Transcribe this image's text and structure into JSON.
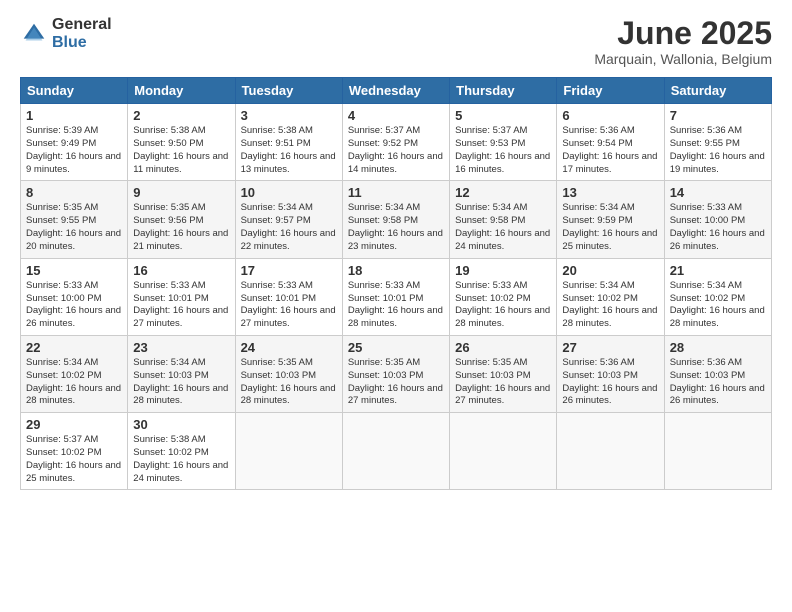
{
  "logo": {
    "general": "General",
    "blue": "Blue"
  },
  "title": "June 2025",
  "location": "Marquain, Wallonia, Belgium",
  "weekdays": [
    "Sunday",
    "Monday",
    "Tuesday",
    "Wednesday",
    "Thursday",
    "Friday",
    "Saturday"
  ],
  "weeks": [
    [
      {
        "day": 1,
        "sunrise": "5:39 AM",
        "sunset": "9:49 PM",
        "daylight": "16 hours and 9 minutes."
      },
      {
        "day": 2,
        "sunrise": "5:38 AM",
        "sunset": "9:50 PM",
        "daylight": "16 hours and 11 minutes."
      },
      {
        "day": 3,
        "sunrise": "5:38 AM",
        "sunset": "9:51 PM",
        "daylight": "16 hours and 13 minutes."
      },
      {
        "day": 4,
        "sunrise": "5:37 AM",
        "sunset": "9:52 PM",
        "daylight": "16 hours and 14 minutes."
      },
      {
        "day": 5,
        "sunrise": "5:37 AM",
        "sunset": "9:53 PM",
        "daylight": "16 hours and 16 minutes."
      },
      {
        "day": 6,
        "sunrise": "5:36 AM",
        "sunset": "9:54 PM",
        "daylight": "16 hours and 17 minutes."
      },
      {
        "day": 7,
        "sunrise": "5:36 AM",
        "sunset": "9:55 PM",
        "daylight": "16 hours and 19 minutes."
      }
    ],
    [
      {
        "day": 8,
        "sunrise": "5:35 AM",
        "sunset": "9:55 PM",
        "daylight": "16 hours and 20 minutes."
      },
      {
        "day": 9,
        "sunrise": "5:35 AM",
        "sunset": "9:56 PM",
        "daylight": "16 hours and 21 minutes."
      },
      {
        "day": 10,
        "sunrise": "5:34 AM",
        "sunset": "9:57 PM",
        "daylight": "16 hours and 22 minutes."
      },
      {
        "day": 11,
        "sunrise": "5:34 AM",
        "sunset": "9:58 PM",
        "daylight": "16 hours and 23 minutes."
      },
      {
        "day": 12,
        "sunrise": "5:34 AM",
        "sunset": "9:58 PM",
        "daylight": "16 hours and 24 minutes."
      },
      {
        "day": 13,
        "sunrise": "5:34 AM",
        "sunset": "9:59 PM",
        "daylight": "16 hours and 25 minutes."
      },
      {
        "day": 14,
        "sunrise": "5:33 AM",
        "sunset": "10:00 PM",
        "daylight": "16 hours and 26 minutes."
      }
    ],
    [
      {
        "day": 15,
        "sunrise": "5:33 AM",
        "sunset": "10:00 PM",
        "daylight": "16 hours and 26 minutes."
      },
      {
        "day": 16,
        "sunrise": "5:33 AM",
        "sunset": "10:01 PM",
        "daylight": "16 hours and 27 minutes."
      },
      {
        "day": 17,
        "sunrise": "5:33 AM",
        "sunset": "10:01 PM",
        "daylight": "16 hours and 27 minutes."
      },
      {
        "day": 18,
        "sunrise": "5:33 AM",
        "sunset": "10:01 PM",
        "daylight": "16 hours and 28 minutes."
      },
      {
        "day": 19,
        "sunrise": "5:33 AM",
        "sunset": "10:02 PM",
        "daylight": "16 hours and 28 minutes."
      },
      {
        "day": 20,
        "sunrise": "5:34 AM",
        "sunset": "10:02 PM",
        "daylight": "16 hours and 28 minutes."
      },
      {
        "day": 21,
        "sunrise": "5:34 AM",
        "sunset": "10:02 PM",
        "daylight": "16 hours and 28 minutes."
      }
    ],
    [
      {
        "day": 22,
        "sunrise": "5:34 AM",
        "sunset": "10:02 PM",
        "daylight": "16 hours and 28 minutes."
      },
      {
        "day": 23,
        "sunrise": "5:34 AM",
        "sunset": "10:03 PM",
        "daylight": "16 hours and 28 minutes."
      },
      {
        "day": 24,
        "sunrise": "5:35 AM",
        "sunset": "10:03 PM",
        "daylight": "16 hours and 28 minutes."
      },
      {
        "day": 25,
        "sunrise": "5:35 AM",
        "sunset": "10:03 PM",
        "daylight": "16 hours and 27 minutes."
      },
      {
        "day": 26,
        "sunrise": "5:35 AM",
        "sunset": "10:03 PM",
        "daylight": "16 hours and 27 minutes."
      },
      {
        "day": 27,
        "sunrise": "5:36 AM",
        "sunset": "10:03 PM",
        "daylight": "16 hours and 26 minutes."
      },
      {
        "day": 28,
        "sunrise": "5:36 AM",
        "sunset": "10:03 PM",
        "daylight": "16 hours and 26 minutes."
      }
    ],
    [
      {
        "day": 29,
        "sunrise": "5:37 AM",
        "sunset": "10:02 PM",
        "daylight": "16 hours and 25 minutes."
      },
      {
        "day": 30,
        "sunrise": "5:38 AM",
        "sunset": "10:02 PM",
        "daylight": "16 hours and 24 minutes."
      },
      null,
      null,
      null,
      null,
      null
    ]
  ]
}
